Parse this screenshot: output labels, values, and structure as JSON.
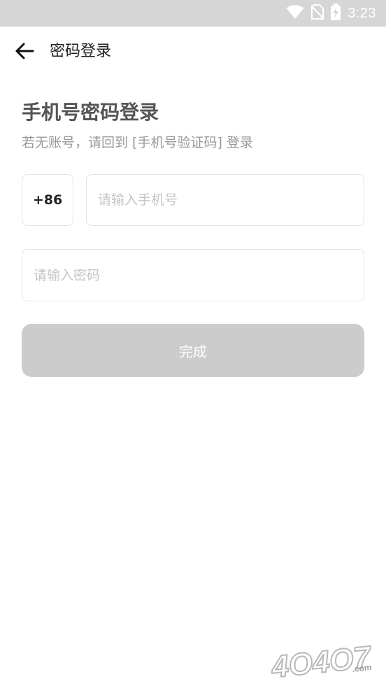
{
  "status_bar": {
    "time": "3:23",
    "icons": [
      "wifi-icon",
      "no-sim-icon",
      "battery-charging-icon"
    ]
  },
  "header": {
    "back_icon": "arrow-left-icon",
    "title": "密码登录"
  },
  "main": {
    "heading": "手机号密码登录",
    "subtitle": "若无账号，请回到 [手机号验证码] 登录",
    "country_code": "+86",
    "phone_input": {
      "value": "",
      "placeholder": "请输入手机号"
    },
    "password_input": {
      "value": "",
      "placeholder": "请输入密码"
    },
    "submit_label": "完成"
  },
  "watermark": {
    "text": "4O4O7",
    "suffix": ".com"
  },
  "colors": {
    "status_bar_bg": "#d6d6d6",
    "heading": "#555555",
    "subtitle": "#9a9a9a",
    "button_disabled_bg": "#cccccc",
    "border": "#e3e3e3"
  }
}
